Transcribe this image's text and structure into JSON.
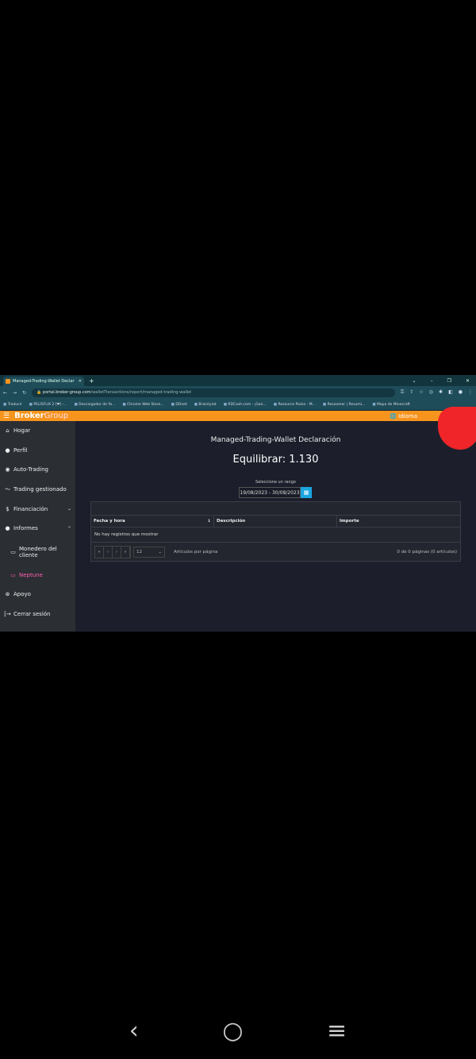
{
  "browser": {
    "tab_title": "Managed-Trading-Wallet Declar",
    "url_domain": "portal.broker-group.com",
    "url_path": "/walletTransactions/report/managed-trading-wallet",
    "bookmarks": [
      "Traducir",
      "PELISFLIX 2 [❤] -...",
      "Descargador de Yo...",
      "Chrome Web Store...",
      "DOnet",
      "Brainly.lat",
      "RDCash.com - ¡Gan...",
      "Resource Packs - M...",
      "Resoomer | Resumi...",
      "Mapa de Minecraft"
    ]
  },
  "header": {
    "logo_a": "Broker",
    "logo_b": "Group",
    "language": "Idioma"
  },
  "sidebar": {
    "items": [
      {
        "label": "Hogar",
        "icon": "⌂"
      },
      {
        "label": "Perfil",
        "icon": "●"
      },
      {
        "label": "Auto-Trading",
        "icon": "◉"
      },
      {
        "label": "Trading gestionado",
        "icon": "〜"
      },
      {
        "label": "Financiación",
        "icon": "$",
        "chev": "⌄"
      },
      {
        "label": "Informes",
        "icon": "●",
        "chev": "⌃"
      },
      {
        "label": "Monedero del cliente",
        "icon": "▭"
      },
      {
        "label": "Neptune",
        "icon": "▭"
      },
      {
        "label": "Apoyo",
        "icon": "⊛"
      },
      {
        "label": "Cerrar sesión",
        "icon": "[→"
      }
    ]
  },
  "main": {
    "title": "Managed-Trading-Wallet Declaración",
    "balance": "Equilibrar: 1.130",
    "range_label": "Seleccione un rango",
    "range_value": "19/08/2023 - 30/08/2023",
    "columns": [
      "Fecha y hora",
      "Descripción",
      "Importe"
    ],
    "empty": "No hay registros que mostrar",
    "page_size": "12",
    "per_page_label": "Artículos por página",
    "page_info": "0 de 0 páginas (0 artículos)"
  }
}
